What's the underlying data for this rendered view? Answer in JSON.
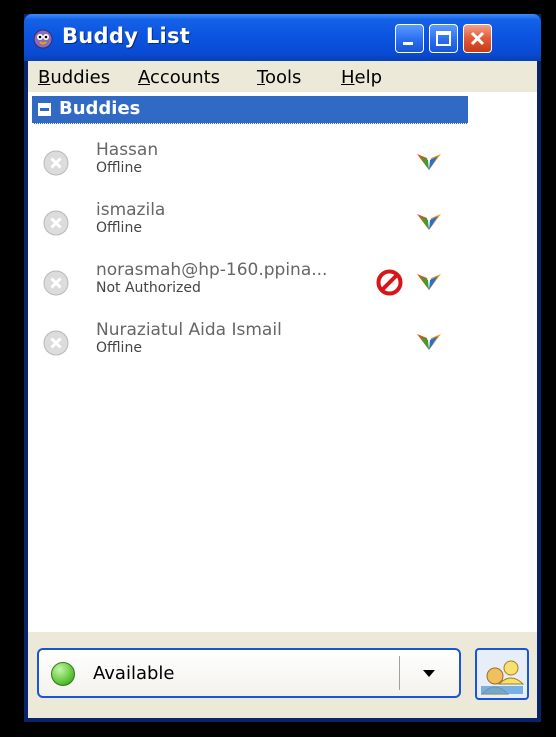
{
  "window": {
    "title": "Buddy List"
  },
  "menu": {
    "items": [
      {
        "accel": "B",
        "rest": "uddies"
      },
      {
        "accel": "A",
        "rest": "ccounts"
      },
      {
        "accel": "T",
        "rest": "ools"
      },
      {
        "accel": "H",
        "rest": "elp"
      }
    ]
  },
  "group": {
    "label": "Buddies"
  },
  "buddies": [
    {
      "name": "Hassan",
      "status": "Offline",
      "blocked": false
    },
    {
      "name": "ismazila",
      "status": "Offline",
      "blocked": false
    },
    {
      "name": "norasmah@hp-160.ppina...",
      "status": "Not Authorized",
      "blocked": true
    },
    {
      "name": "Nuraziatul Aida Ismail",
      "status": "Offline",
      "blocked": false
    }
  ],
  "status_selector": {
    "value": "Available"
  },
  "icons": {
    "app": "pidgin-icon",
    "offline": "offline-status-icon",
    "protocol": "msn-butterfly-icon",
    "blocked": "blocked-icon",
    "available": "available-status-icon",
    "avatar": "buddy-icon-button"
  }
}
